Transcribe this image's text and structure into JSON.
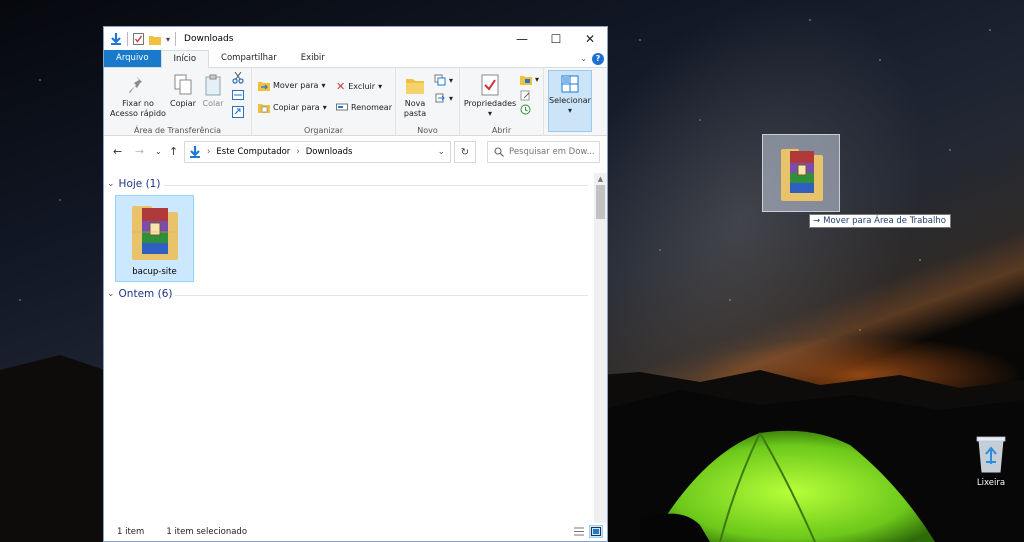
{
  "window": {
    "title": "Downloads",
    "controls": {
      "minimize": "—",
      "maximize": "☐",
      "close": "✕"
    }
  },
  "ribbon_tabs": [
    {
      "label": "Arquivo"
    },
    {
      "label": "Início"
    },
    {
      "label": "Compartilhar"
    },
    {
      "label": "Exibir"
    }
  ],
  "ribbon": {
    "clipboard": {
      "pin_label_1": "Fixar no",
      "pin_label_2": "Acesso rápido",
      "copy_label": "Copiar",
      "paste_label": "Colar",
      "group_label": "Área de Transferência"
    },
    "organize": {
      "move_to": "Mover para",
      "copy_to": "Copiar para",
      "delete": "Excluir",
      "rename": "Renomear",
      "group_label": "Organizar"
    },
    "new": {
      "new_folder_1": "Nova",
      "new_folder_2": "pasta",
      "group_label": "Novo"
    },
    "open": {
      "properties": "Propriedades",
      "group_label": "Abrir"
    },
    "select": {
      "label": "Selecionar"
    }
  },
  "address": {
    "crumbs": [
      "Este Computador",
      "Downloads"
    ],
    "search_placeholder": "Pesquisar em Dow..."
  },
  "groups": [
    {
      "label": "Hoje (1)"
    },
    {
      "label": "Ontem (6)"
    }
  ],
  "files": [
    {
      "name": "bacup-site",
      "icon": "winrar-archive-icon"
    }
  ],
  "status": {
    "count": "1 item",
    "selected": "1 item selecionado"
  },
  "drag": {
    "tooltip_arrow": "→",
    "tooltip": "Mover para Área de Trabalho"
  },
  "desktop": {
    "recycle_bin": "Lixeira"
  },
  "colors": {
    "file_tab": "#1979ca",
    "selection": "#cce8ff",
    "group_header": "#1e3287"
  }
}
